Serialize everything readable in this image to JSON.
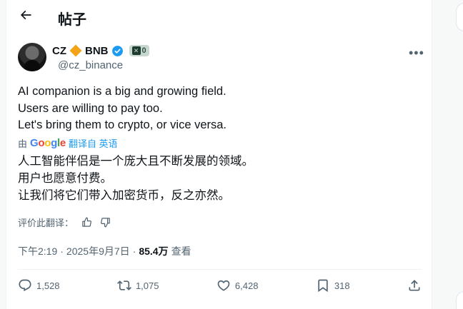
{
  "header": {
    "back_icon": "arrow-left-icon",
    "title": "帖子"
  },
  "author": {
    "display_name": "CZ",
    "name_suffix": "BNB",
    "handle": "@cz_binance",
    "badge_count": "0",
    "diamond_color": "#f3a317",
    "verified_color": "#1d9bf0"
  },
  "tweet": {
    "text": "AI companion is a big and growing field.\nUsers are willing to pay too.\nLet's bring them to crypto, or vice versa.",
    "translated_by_prefix": "由",
    "translate_label": "翻译自 英语",
    "translated_text": "人工智能伴侣是一个庞大且不断发展的领域。\n用户也愿意付费。\n让我们将它们带入加密货币，反之亦然。",
    "rate_label": "评价此翻译："
  },
  "meta": {
    "time": "下午2:19",
    "separator": "·",
    "date": "2025年9月7日",
    "separator2": "·",
    "views": "85.4万",
    "views_label": "查看"
  },
  "actions": {
    "replies": "1,528",
    "reposts": "1,075",
    "likes": "6,428",
    "bookmarks": "318"
  }
}
